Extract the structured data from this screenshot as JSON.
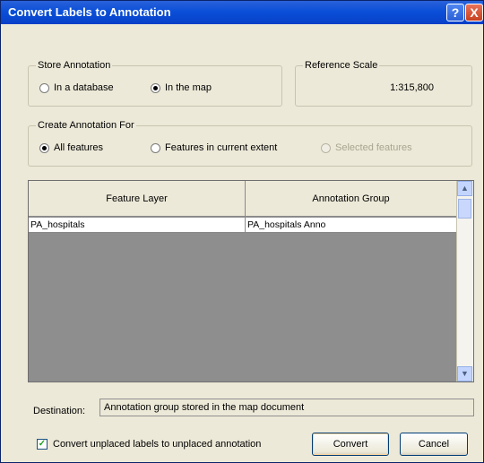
{
  "window": {
    "title": "Convert Labels to Annotation",
    "help_glyph": "?",
    "close_glyph": "X"
  },
  "store_annotation": {
    "legend": "Store Annotation",
    "options": [
      {
        "label": "In a database",
        "selected": false
      },
      {
        "label": "In the map",
        "selected": true
      }
    ]
  },
  "reference_scale": {
    "legend": "Reference Scale",
    "value": "1:315,800"
  },
  "create_for": {
    "legend": "Create Annotation For",
    "options": [
      {
        "label": "All features",
        "selected": true,
        "enabled": true
      },
      {
        "label": "Features in current extent",
        "selected": false,
        "enabled": true
      },
      {
        "label": "Selected features",
        "selected": false,
        "enabled": false
      }
    ]
  },
  "table": {
    "columns": [
      "Feature Layer",
      "Annotation Group"
    ],
    "rows": [
      [
        "PA_hospitals",
        "PA_hospitals Anno"
      ]
    ]
  },
  "scroll_glyphs": {
    "up": "▲",
    "down": "▼"
  },
  "destination": {
    "label": "Destination:",
    "value": "Annotation group stored in the map document"
  },
  "unplaced": {
    "label": "Convert unplaced labels to unplaced annotation",
    "checked": true,
    "check_glyph": "✓"
  },
  "buttons": {
    "convert": "Convert",
    "cancel": "Cancel"
  },
  "colors": {
    "titlebar": "#0a4fd8",
    "dialog_bg": "#ece9d8",
    "table_bg": "#8e8e8e"
  }
}
